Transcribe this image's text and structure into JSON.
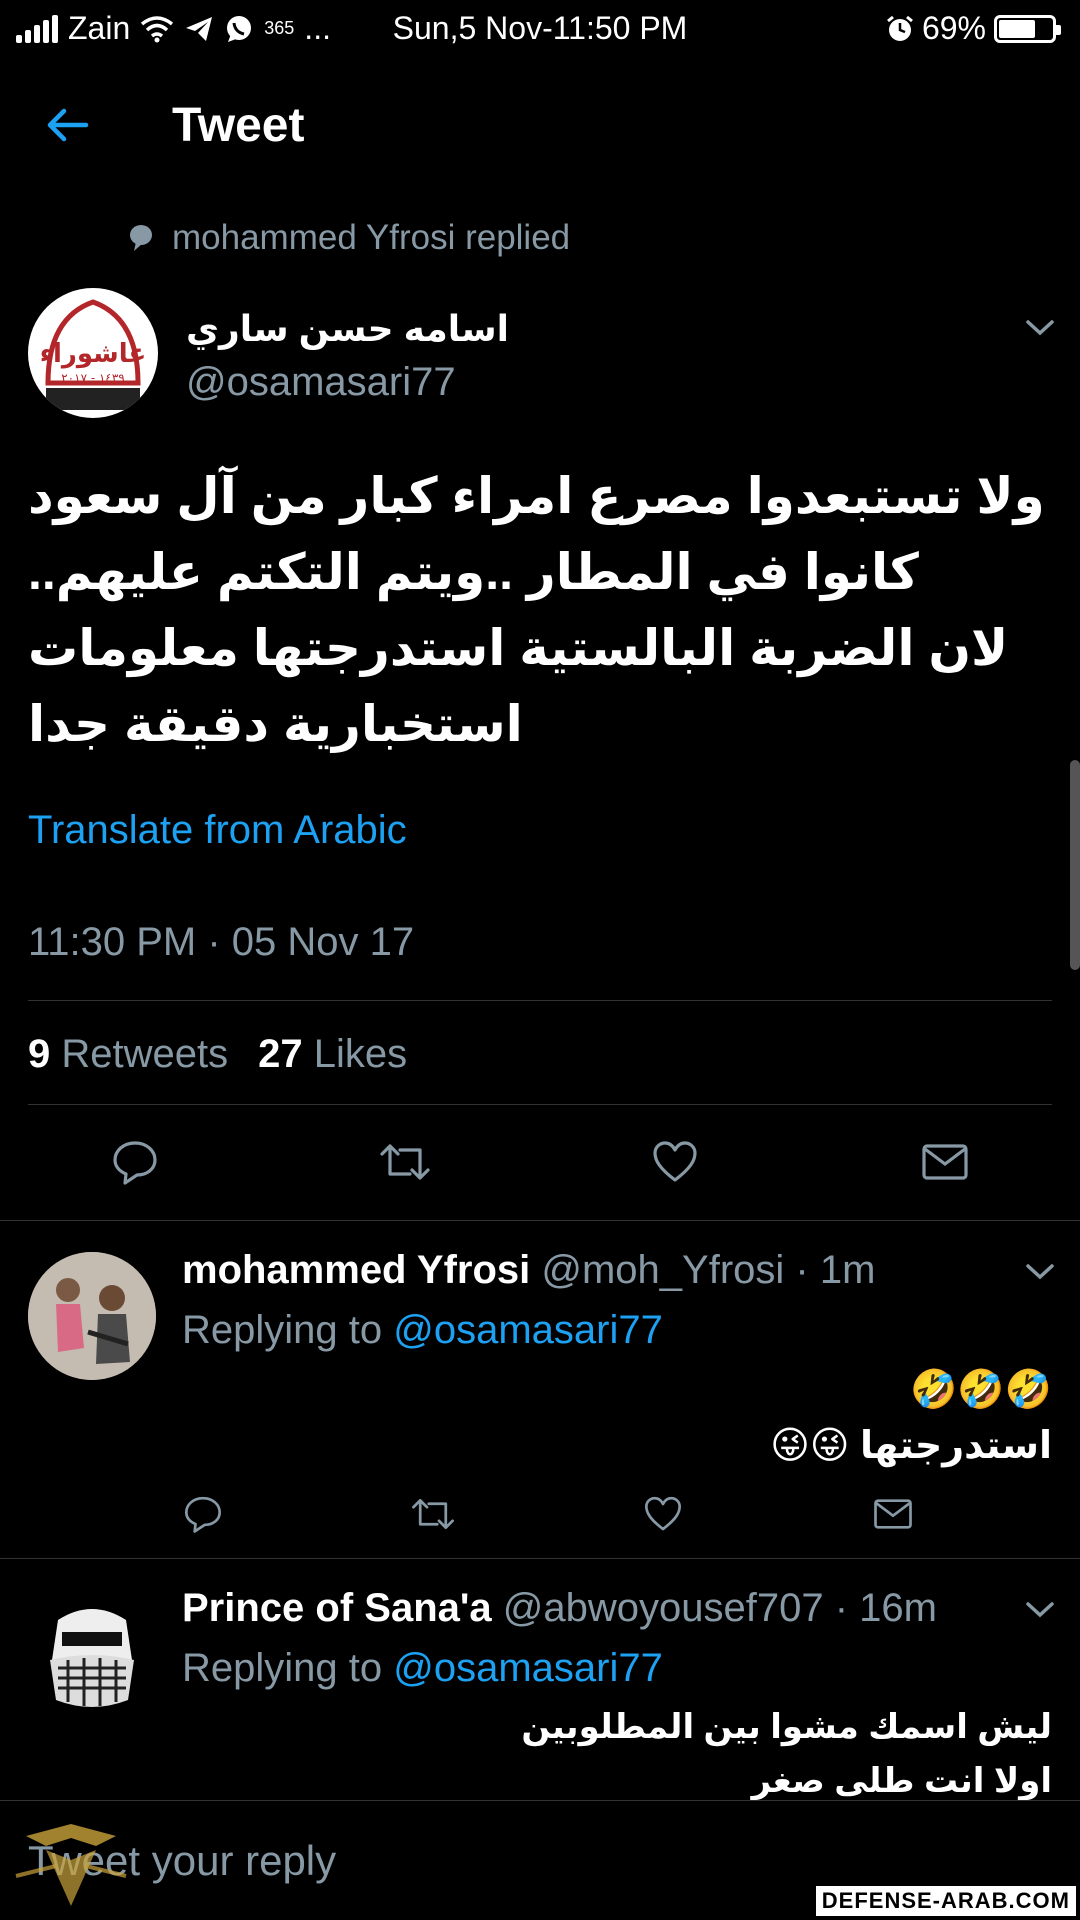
{
  "status_bar": {
    "carrier": "Zain",
    "extra": "365",
    "dots": "...",
    "datetime": "Sun,5 Nov-11:50 PM",
    "battery": "69%",
    "battery_level": 0.69
  },
  "header": {
    "title": "Tweet"
  },
  "social_context": "mohammed Yfrosi replied",
  "tweet": {
    "author_name": "اسامه حسن ساري",
    "author_handle": "@osamasari77",
    "text": "ولا تستبعدوا مصرع امراء كبار من آل سعود كانوا في المطار ..ويتم التكتم عليهم..\nلان الضربة البالستية استدرجتها معلومات استخبارية دقيقة جدا",
    "translate": "Translate from Arabic",
    "timestamp": "11:30 PM · 05 Nov 17",
    "retweets_count": "9",
    "retweets_label": "Retweets",
    "likes_count": "27",
    "likes_label": "Likes",
    "avatar_text": "عاشوراء",
    "avatar_sub": "١٤٣٩ - ٢٠١٧"
  },
  "replies": [
    {
      "name": "mohammed Yfrosi",
      "handle": "@moh_Yfrosi",
      "time": "· 1m",
      "replying_label": "Replying to",
      "replying_to": "@osamasari77",
      "text": "🤣🤣🤣\nاستدرجتها 😜😜"
    },
    {
      "name": "Prince of Sana'a",
      "handle": "@abwoyousef707",
      "time": "· 16m",
      "replying_label": "Replying to",
      "replying_to": "@osamasari77",
      "text": "ليش اسمك مشوا بين المطلوبين\nاولا انت طلى صغر"
    }
  ],
  "compose": {
    "placeholder": "Tweet your reply"
  },
  "watermark": "DEFENSE-ARAB.COM",
  "colors": {
    "accent": "#1da1f2",
    "secondary": "#8899a6",
    "divider": "#2f3336"
  }
}
